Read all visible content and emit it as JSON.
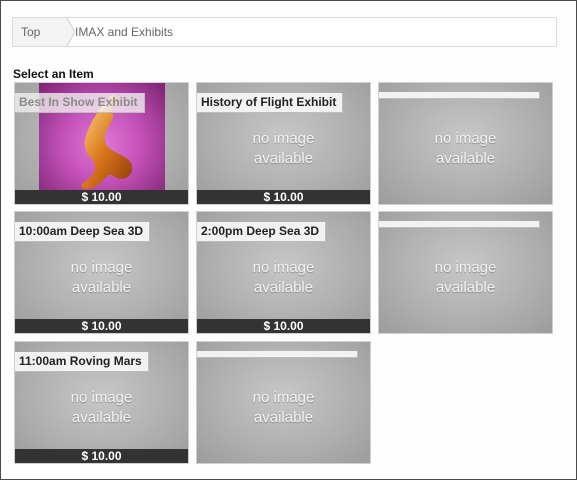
{
  "breadcrumb": {
    "top": "Top",
    "current": "IMAX and Exhibits"
  },
  "section_title": "Select an Item",
  "no_image_line1": "no image",
  "no_image_line2": "available",
  "items": [
    {
      "title": "Best In Show Exhibit",
      "price": "$ 10.00",
      "has_image": true
    },
    {
      "title": "History of Flight Exhibit",
      "price": "$ 10.00",
      "has_image": false
    },
    {
      "title": "",
      "price": "",
      "has_image": false
    },
    {
      "title": "10:00am Deep Sea 3D",
      "price": "$ 10.00",
      "has_image": false
    },
    {
      "title": "2:00pm Deep Sea 3D",
      "price": "$ 10.00",
      "has_image": false
    },
    {
      "title": "",
      "price": "",
      "has_image": false
    },
    {
      "title": "11:00am Roving Mars",
      "price": "$ 10.00",
      "has_image": false
    },
    {
      "title": "",
      "price": "",
      "has_image": false
    }
  ]
}
